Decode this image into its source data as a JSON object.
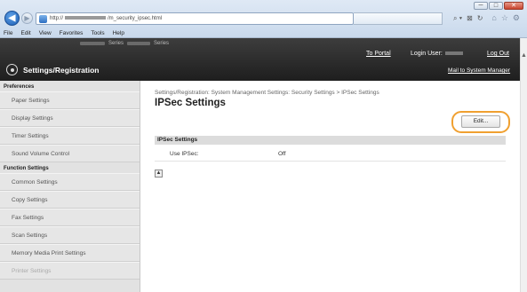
{
  "browser": {
    "url_prefix": "http://",
    "url_suffix": "/m_security_ipsec.html",
    "window_controls": [
      "─",
      "□",
      "✕"
    ],
    "address_tools": [
      "⌕ ▾",
      "⊠",
      "↻"
    ],
    "star_icons": [
      "⌂",
      "☆",
      "⚙"
    ],
    "menu": [
      "File",
      "Edit",
      "View",
      "Favorites",
      "Tools",
      "Help"
    ]
  },
  "header": {
    "model_text_1": "Series",
    "model_text_2": "Series",
    "portal_link": "To Portal",
    "login_label": "Login User:",
    "logout_link": "Log Out",
    "mail_link": "Mail to System Manager",
    "app_title": "Settings/Registration"
  },
  "sidebar": {
    "preferences_heading": "Preferences",
    "preferences": [
      "Paper Settings",
      "Display Settings",
      "Timer Settings",
      "Sound Volume Control"
    ],
    "function_heading": "Function Settings",
    "functions": [
      "Common Settings",
      "Copy Settings",
      "Fax Settings",
      "Scan Settings",
      "Memory Media Print Settings",
      "Printer Settings"
    ]
  },
  "main": {
    "breadcrumb": "Settings/Registration: System Management Settings: Security Settings > IPSec Settings",
    "title": "IPSec Settings",
    "edit_button": "Edit...",
    "section_title": "IPSec Settings",
    "rows": [
      {
        "label": "Use IPSec:",
        "value": "Off"
      }
    ],
    "top_icon": "▲"
  },
  "colors": {
    "header_bg": "#2b2b2b",
    "sidebar_bg": "#e2e2e2",
    "highlight_ring": "#f0a030"
  }
}
